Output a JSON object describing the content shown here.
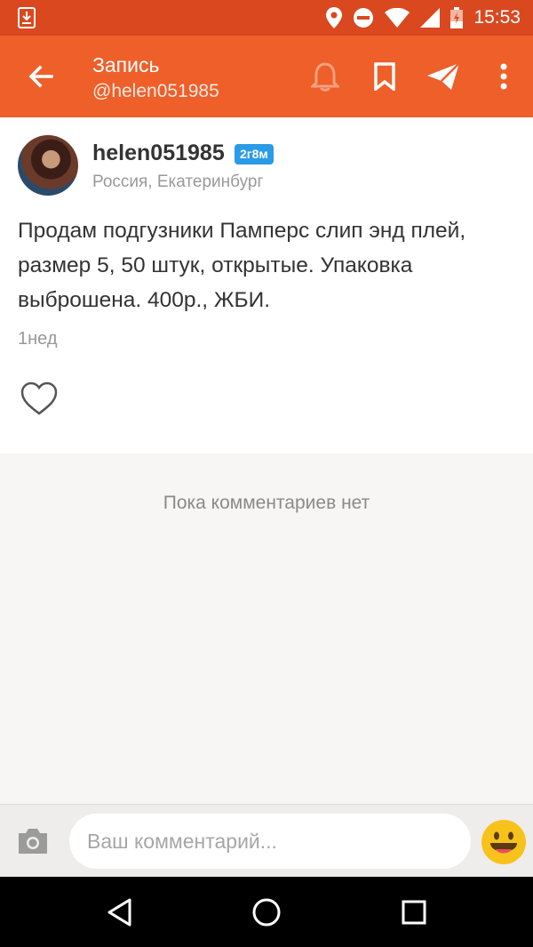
{
  "status_bar": {
    "time": "15:53"
  },
  "app_bar": {
    "title": "Запись",
    "subtitle": "@helen051985"
  },
  "post": {
    "username": "helen051985",
    "badge": "2г8м",
    "location": "Россия, Екатеринбург",
    "text": "Продам подгузники Памперс слип энд плей, размер 5, 50 штук, открытые. Упаковка выброшена. 400р., ЖБИ.",
    "time_ago": "1нед"
  },
  "comments": {
    "empty_text": "Пока комментариев нет"
  },
  "comment_input": {
    "placeholder": "Ваш комментарий...",
    "value": ""
  },
  "colors": {
    "status_bar": "#d9481f",
    "app_bar": "#ee5f2a",
    "badge": "#2a9be6",
    "bell_icon": "#f4a17f"
  }
}
